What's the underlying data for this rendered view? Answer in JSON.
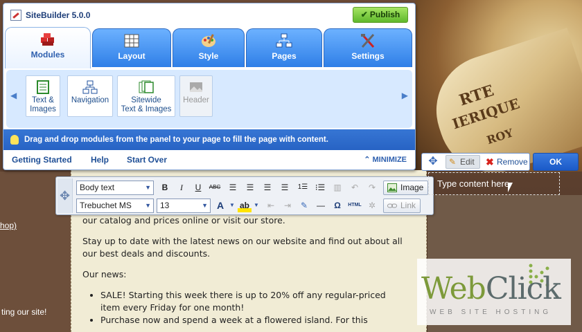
{
  "app": {
    "title": "SiteBuilder 5.0.0",
    "publish_label": "Publish"
  },
  "tabs": [
    {
      "label": "Modules",
      "active": true
    },
    {
      "label": "Layout",
      "active": false
    },
    {
      "label": "Style",
      "active": false
    },
    {
      "label": "Pages",
      "active": false
    },
    {
      "label": "Settings",
      "active": false
    }
  ],
  "modules": [
    {
      "label": "Text &\nImages",
      "disabled": false
    },
    {
      "label": "Navigation",
      "disabled": false
    },
    {
      "label": "Sitewide\nText & Images",
      "disabled": false
    },
    {
      "label": "Header",
      "disabled": true
    }
  ],
  "hint": "Drag and drop modules from the panel to your page to fill the page with content.",
  "footer_links": {
    "getting_started": "Getting Started",
    "help": "Help",
    "start_over": "Start Over",
    "minimize": "MINIMIZE"
  },
  "editor": {
    "style_select": "Body text",
    "font_select": "Trebuchet MS",
    "size_select": "13",
    "image_button": "Image",
    "link_button": "Link"
  },
  "element_controls": {
    "edit_label": "Edit",
    "remove_label": "Remove",
    "ok_label": "OK",
    "placeholder_text": "Type content here"
  },
  "site": {
    "left_link": "hop)",
    "left_text": "ting our site!",
    "paragraphs": [
      "our catalog and prices online or visit our store.",
      "Stay up to date with the latest news on our website and find out about all our best deals and discounts.",
      "Our news:"
    ],
    "news": [
      "SALE! Starting this week there is up to 20% off any regular-priced item every Friday for one month!",
      "Purchase now and spend a week at a flowered island. For this"
    ]
  },
  "logo": {
    "word_a": "Web",
    "word_b": "Click",
    "tagline": "WEB SITE HOSTING"
  }
}
